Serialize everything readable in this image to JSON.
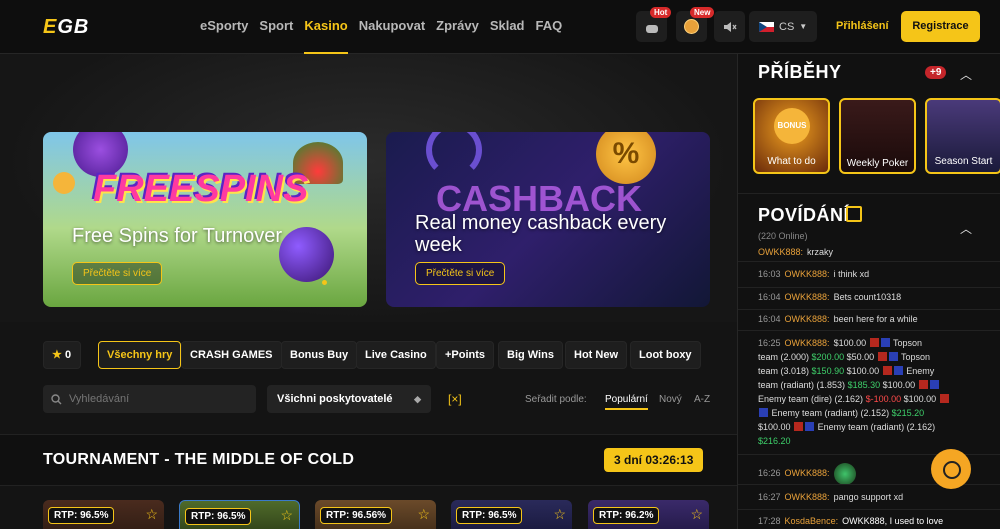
{
  "header": {
    "logo_main": "E",
    "logo_rest": "GB",
    "nav": [
      "eSporty",
      "Sport",
      "Kasino",
      "Nakupovat",
      "Zprávy",
      "Sklad",
      "FAQ"
    ],
    "active_nav": "Kasino",
    "badge_hot": "Hot",
    "badge_new": "New",
    "language": "CS",
    "login": "Přihlášení",
    "register": "Registrace"
  },
  "banners": [
    {
      "logo_text": "FREESPINS",
      "title": "Free Spins for Turnover",
      "button": "Přečtěte si více"
    },
    {
      "logo_text": "CASHBACK",
      "title": "Real money cashback every week",
      "button": "Přečtěte si více"
    }
  ],
  "categories": {
    "favorites_count": "0",
    "items": [
      "Všechny hry",
      "CRASH GAMES",
      "Bonus Buy",
      "Live Casino",
      "+Points",
      "Big Wins",
      "Hot New",
      "Loot boxy"
    ]
  },
  "filters": {
    "search_placeholder": "Vyhledávání",
    "provider": "Všichni poskytovatelé",
    "clear_icon": "[×]",
    "sort_label": "Seřadit podle:",
    "sort_options": [
      "Populární",
      "Nový",
      "A-Z"
    ]
  },
  "tournament": {
    "title": "TOURNAMENT - THE MIDDLE OF COLD",
    "timer": "3 dní 03:26:13"
  },
  "games": [
    {
      "rtp": "RTP: 96.5%"
    },
    {
      "rtp": "RTP: 96.5%"
    },
    {
      "rtp": "RTP: 96.56%"
    },
    {
      "rtp": "RTP: 96.5%"
    },
    {
      "rtp": "RTP: 96.2%"
    }
  ],
  "sidebar": {
    "stories_title": "PŘÍBĚHY",
    "stories_count": "+9",
    "stories": [
      {
        "label": "What to do",
        "coin": "BONUS"
      },
      {
        "label": "Weekly Poker"
      },
      {
        "label": "Season Start"
      }
    ],
    "chat_title": "POVÍDÁNÍ",
    "chat_online": "(220 Online)",
    "chat_messages": [
      {
        "time": "",
        "user": "OWKK888:",
        "text": "krzaky"
      },
      {
        "time": "16:03",
        "user": "OWKK888:",
        "text": "i think xd"
      },
      {
        "time": "16:04",
        "user": "OWKK888:",
        "text": "Bets count10318"
      },
      {
        "time": "16:04",
        "user": "OWKK888:",
        "text": "been here for a while"
      },
      {
        "time": "16:25",
        "user": "OWKK888:",
        "text": ""
      },
      {
        "time": "16:26",
        "user": "OWKK888:",
        "text": ""
      },
      {
        "time": "16:27",
        "user": "OWKK888:",
        "text": "pango support xd"
      },
      {
        "time": "17:28",
        "user": "KosdaBence:",
        "text": "OWKK888, I used to love"
      }
    ],
    "bet_lines": [
      {
        "a": "$100.00",
        "b": "Topson"
      },
      {
        "a": "team (2.000)",
        "g1": "$200.00",
        "c": "$50.00",
        "d": "Topson"
      },
      {
        "a": "team (3.018)",
        "g1": "$150.90",
        "c": "$100.00",
        "d": "Enemy"
      },
      {
        "a": "team (radiant) (1.853)",
        "g1": "$185.30",
        "c": "$100.00"
      },
      {
        "a": "Enemy team (dire) (2.162)",
        "r1": "$-100.00",
        "c": "$100.00"
      },
      {
        "a": "Enemy team (radiant) (2.152)",
        "g1": "$215.20"
      },
      {
        "a": "$100.00",
        "b": "Enemy team (radiant) (2.162)"
      },
      {
        "g1": "$216.20"
      }
    ]
  }
}
